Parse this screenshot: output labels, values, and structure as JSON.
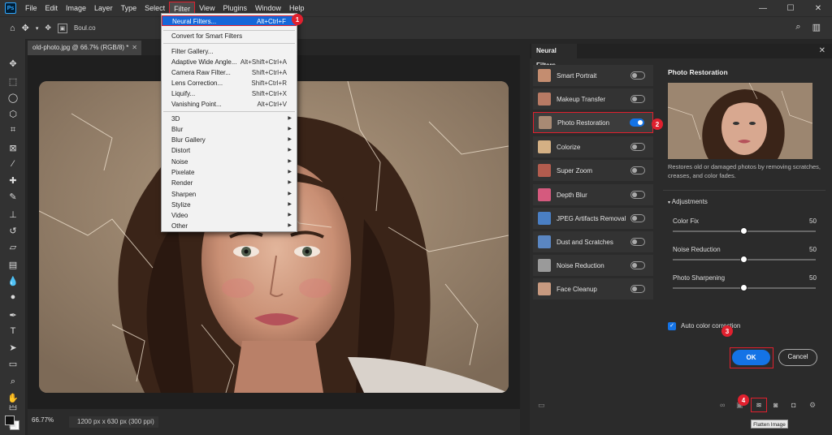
{
  "menubar": {
    "logo": "Ps",
    "items": [
      "File",
      "Edit",
      "Image",
      "Layer",
      "Type",
      "Select",
      "Filter",
      "View",
      "Plugins",
      "Window",
      "Help"
    ],
    "active_item": "Filter"
  },
  "optbar": {
    "text": "Boul.co"
  },
  "document": {
    "tab_title": "old-photo.jpg @ 66.7% (RGB/8) *",
    "zoom": "66.77%",
    "info": "1200 px x 630 px (300 ppi)"
  },
  "filter_menu": {
    "items": [
      {
        "label": "Neural Filters...",
        "shortcut": "Alt+Ctrl+F"
      },
      {
        "label": "Convert for Smart Filters",
        "shortcut": ""
      },
      {
        "label": "Filter Gallery...",
        "shortcut": ""
      },
      {
        "label": "Adaptive Wide Angle...",
        "shortcut": "Alt+Shift+Ctrl+A"
      },
      {
        "label": "Camera Raw Filter...",
        "shortcut": "Shift+Ctrl+A"
      },
      {
        "label": "Lens Correction...",
        "shortcut": "Shift+Ctrl+R"
      },
      {
        "label": "Liquify...",
        "shortcut": "Shift+Ctrl+X"
      },
      {
        "label": "Vanishing Point...",
        "shortcut": "Alt+Ctrl+V"
      },
      {
        "label": "3D",
        "shortcut": ""
      },
      {
        "label": "Blur",
        "shortcut": ""
      },
      {
        "label": "Blur Gallery",
        "shortcut": ""
      },
      {
        "label": "Distort",
        "shortcut": ""
      },
      {
        "label": "Noise",
        "shortcut": ""
      },
      {
        "label": "Pixelate",
        "shortcut": ""
      },
      {
        "label": "Render",
        "shortcut": ""
      },
      {
        "label": "Sharpen",
        "shortcut": ""
      },
      {
        "label": "Stylize",
        "shortcut": ""
      },
      {
        "label": "Video",
        "shortcut": ""
      },
      {
        "label": "Other",
        "shortcut": ""
      }
    ]
  },
  "badges": [
    "1",
    "2",
    "3",
    "4"
  ],
  "neural_filters": {
    "tab": "Neural Filters",
    "list": [
      {
        "label": "Smart Portrait",
        "on": false
      },
      {
        "label": "Makeup Transfer",
        "on": false
      },
      {
        "label": "Photo Restoration",
        "on": true
      },
      {
        "label": "Colorize",
        "on": false
      },
      {
        "label": "Super Zoom",
        "on": false
      },
      {
        "label": "Depth Blur",
        "on": false
      },
      {
        "label": "JPEG Artifacts Removal",
        "on": false
      },
      {
        "label": "Dust and Scratches",
        "on": false
      },
      {
        "label": "Noise Reduction",
        "on": false
      },
      {
        "label": "Face Cleanup",
        "on": false
      }
    ],
    "detail": {
      "title": "Photo Restoration",
      "description": "Restores old or damaged photos by removing scratches, creases, and color fades.",
      "adjustments_label": "Adjustments",
      "sliders": [
        {
          "label": "Color Fix",
          "value": "50",
          "fraction": 0.5
        },
        {
          "label": "Noise Reduction",
          "value": "50",
          "fraction": 0.5
        },
        {
          "label": "Photo Sharpening",
          "value": "50",
          "fraction": 0.5
        }
      ],
      "checkbox_label": "Auto color correction",
      "ok_label": "OK",
      "cancel_label": "Cancel"
    },
    "tooltip": "Flatten Image"
  },
  "colors": {
    "accent": "#1473e6",
    "highlight": "#e0202e"
  }
}
